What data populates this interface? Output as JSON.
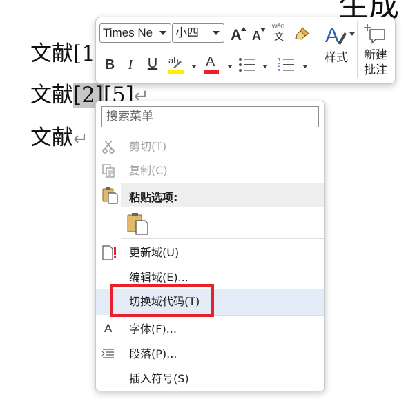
{
  "document": {
    "title_fragment": "生成",
    "lines": [
      {
        "prefix": "文献[1",
        "selected": "",
        "suffix": "",
        "mark": ""
      },
      {
        "prefix": "文献",
        "selected": "[2]",
        "suffix": "[5]",
        "mark": "↵"
      },
      {
        "prefix": "文献",
        "selected": "",
        "suffix": "",
        "mark": "↵"
      }
    ]
  },
  "toolbar": {
    "font_name": "Times Ne",
    "font_size": "小四",
    "grow_font_label": "A",
    "shrink_font_label": "A",
    "phonetic_top": "wén",
    "phonetic_bottom": "文",
    "bold_label": "B",
    "italic_label": "I",
    "underline_label": "U",
    "highlight_label": "ab",
    "font_color_label": "A",
    "styles_label": "样式",
    "new_comment_line1": "新建",
    "new_comment_line2": "批注",
    "highlight_color": "#ffee00",
    "font_color": "#e8212a"
  },
  "menu": {
    "search_placeholder": "搜索菜单",
    "items": [
      {
        "label": "剪切(T)",
        "icon": "scissors-icon",
        "enabled": false
      },
      {
        "label": "复制(C)",
        "icon": "copy-icon",
        "enabled": false
      },
      {
        "label": "粘贴选项:",
        "icon": "paste-icon",
        "enabled": true
      },
      {
        "label": "更新域(U)",
        "icon": "update-field-icon",
        "enabled": true
      },
      {
        "label": "编辑域(E)...",
        "icon": "",
        "enabled": true
      },
      {
        "label": "切换域代码(T)",
        "icon": "",
        "enabled": true,
        "highlighted": true
      },
      {
        "label": "字体(F)...",
        "icon": "font-icon",
        "enabled": true
      },
      {
        "label": "段落(P)...",
        "icon": "paragraph-icon",
        "enabled": true
      },
      {
        "label": "插入符号(S)",
        "icon": "",
        "enabled": true
      }
    ],
    "font_icon_glyph": "A"
  },
  "colors": {
    "accent_highlight": "#e4ecf7",
    "annotation_red": "#e8212a",
    "selection_gray": "#c6c6c6"
  }
}
